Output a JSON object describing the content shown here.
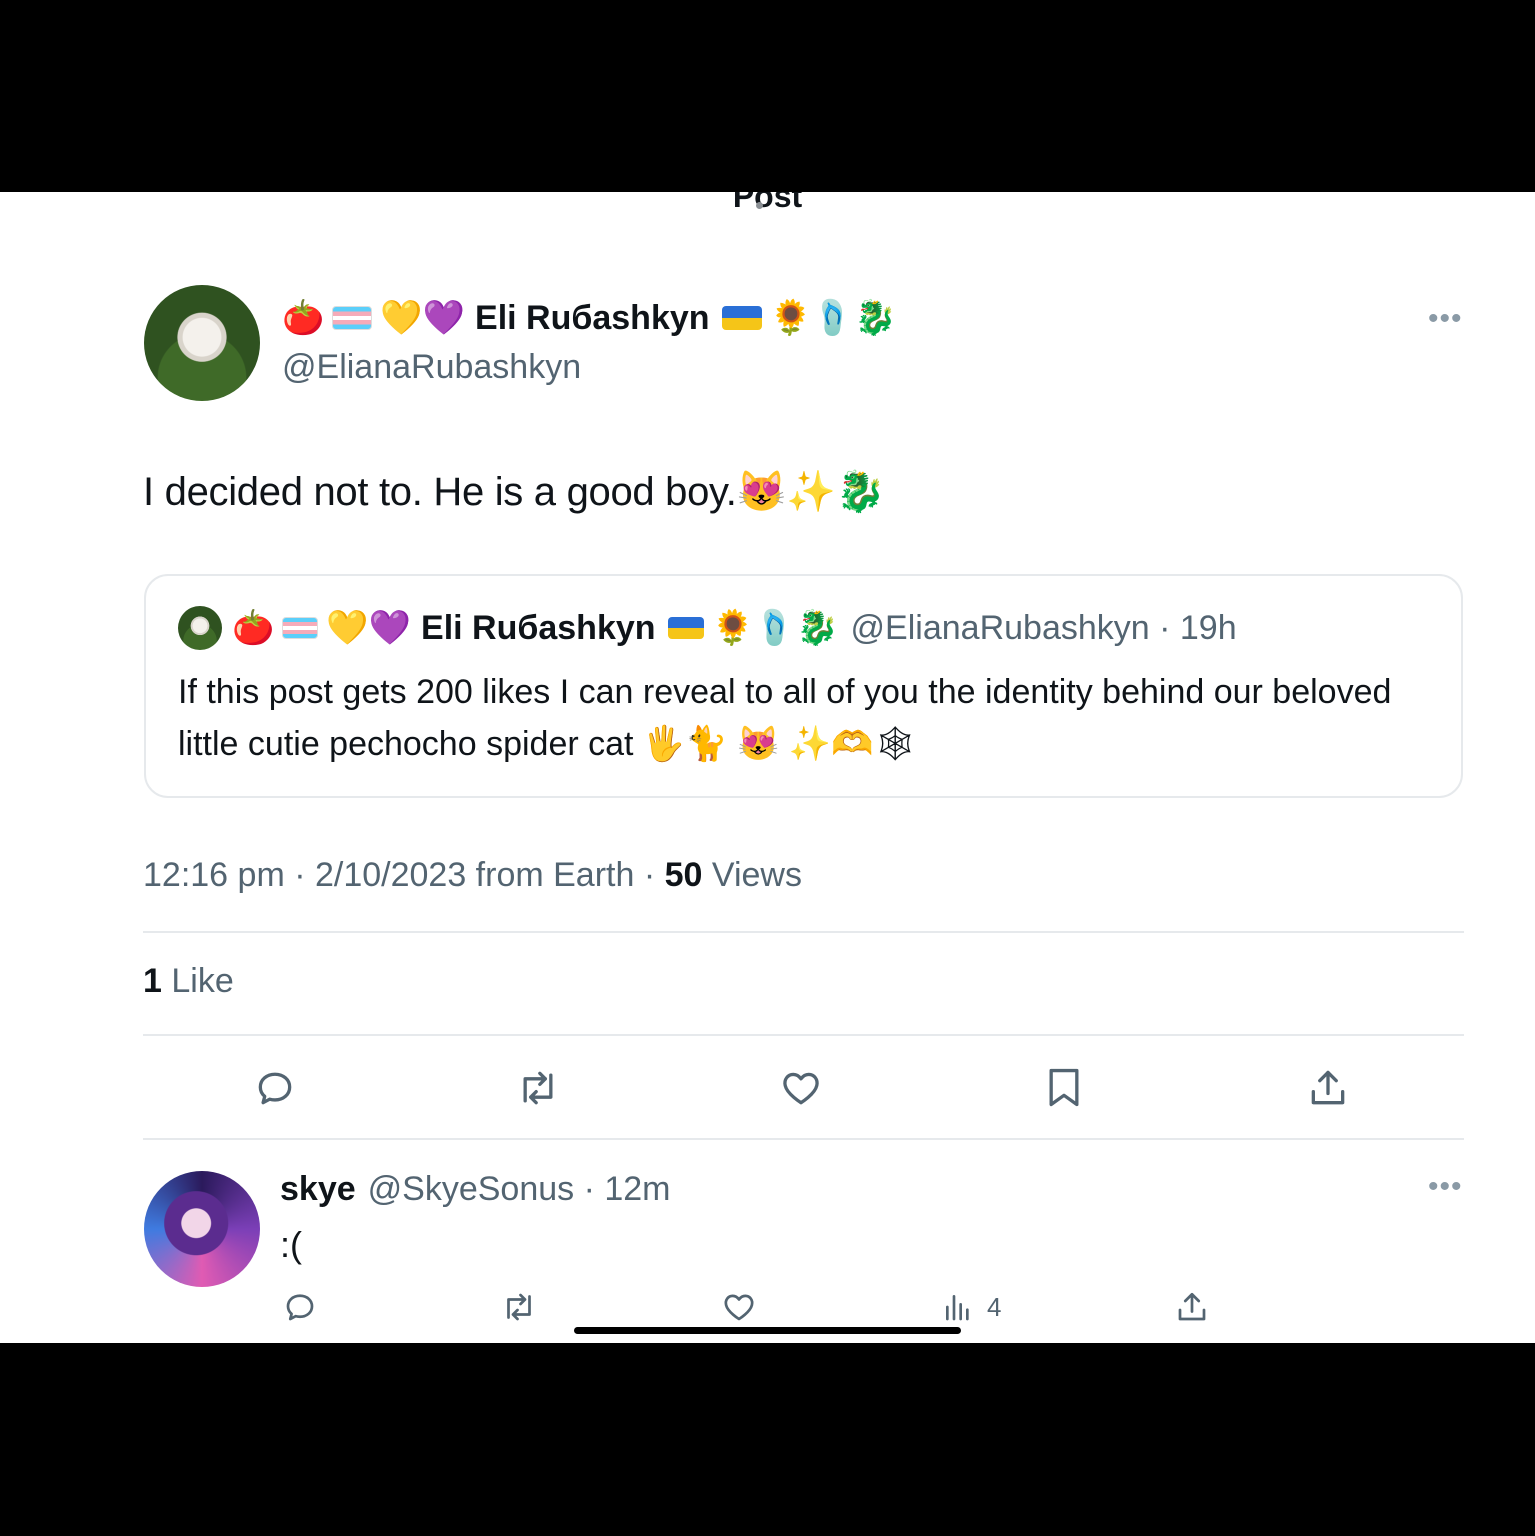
{
  "header": {
    "title": "Post"
  },
  "post": {
    "emoji_prefix": "🍅",
    "emoji_prefix2": "💛💜",
    "display_name": "Eli Ruбashkyn",
    "emoji_suffix": "🌻🩴🐉",
    "handle": "@ElianaRubashkyn",
    "text": "I decided not to. He is a good boy.😻✨🐉",
    "timestamp": "12:16 pm · 2/10/2023 from Earth · ",
    "views_count": "50",
    "views_label": " Views",
    "likes_count": "1",
    "likes_label": " Like"
  },
  "quoted": {
    "emoji_prefix": "🍅",
    "emoji_prefix2": "💛💜",
    "display_name": "Eli Ruбashkyn",
    "emoji_suffix": "🌻🩴🐉",
    "handle_time": "@ElianaRubashkyn · 19h",
    "text": "If this post gets 200 likes I can reveal to all of you the identity behind our beloved little cutie pechocho spider cat 🖐🐈 😻 ✨🫶🕸"
  },
  "reply": {
    "display_name": "skye",
    "handle_time": "@SkyeSonus · 12m",
    "text": ":(",
    "views": "4"
  },
  "icons": {
    "more": "more-icon",
    "reply": "reply-icon",
    "repost": "repost-icon",
    "like": "heart-icon",
    "bookmark": "bookmark-icon",
    "share": "share-icon",
    "views": "views-icon"
  },
  "colors": {
    "secondary_text": "#536471",
    "divider": "#e6e9ec"
  }
}
